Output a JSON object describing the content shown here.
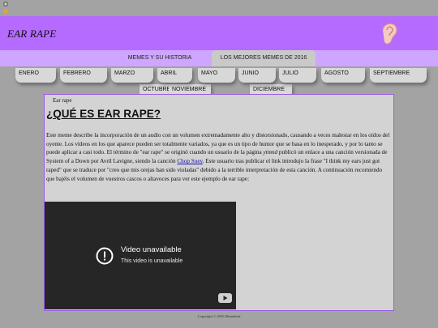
{
  "header": {
    "title": "EAR RAPE",
    "logo_icon": "ear-icon",
    "background": "#b56bff"
  },
  "nav": {
    "tabs": [
      {
        "label": "MEMES Y SU HISTORIA",
        "active": false
      },
      {
        "label": "LOS MEJORES MEMES DE 2016",
        "active": true
      }
    ],
    "background": "#cfa6ff"
  },
  "months": {
    "row1": [
      "ENERO",
      "FEBRERO",
      "MARZO",
      "ABRIL",
      "MAYO",
      "JUNIO",
      "JULIO",
      "AGOSTO",
      "SEPTIEMBRE"
    ],
    "row2": [
      "OCTUBRE",
      "NOVIEMBRE",
      "DICIEMBRE"
    ]
  },
  "content": {
    "breadcrumb": "Ear rape",
    "heading": "¿QUÉ ES EAR RAPE?",
    "para_part1": "Este meme describe la incorporación de un audio con un volumen extremadamente alto y distorsionado, causando a veces malestar en los oídos del oyente. Los vídeos en los que aparece pueden ser totalmente variados, ya que es un tipo de humor que se basa en lo inesperado, y por lo tanto se puede aplicar a casi todo. El término de \"ear rape\" se originó cuando un usuario de la página ",
    "para_em": "ytmnd",
    "para_part2": " publicó un enlace a una canción versionada de System of a Down por Avril Lavigne, siendo la canción ",
    "para_link": "Chop Suey",
    "para_part3": ". Este usuario tras publicar el link introdujo la frase \"I think my ears just got raped\" que se traduce por \"creo que mis orejas han sido violadas\" debido a la terrible interpretación de esta canción. A continuación recomiendo que bajéis el volumen de vuestros cascos o altavoces para ver este ejemplo de ear rape:",
    "video": {
      "title": "Video unavailable",
      "subtitle": "This video is unavailable",
      "status_icon": "exclamation-circle-icon",
      "brand_icon": "youtube-icon"
    }
  },
  "footer": {
    "text": "Copyright © 2016 Memebird"
  }
}
